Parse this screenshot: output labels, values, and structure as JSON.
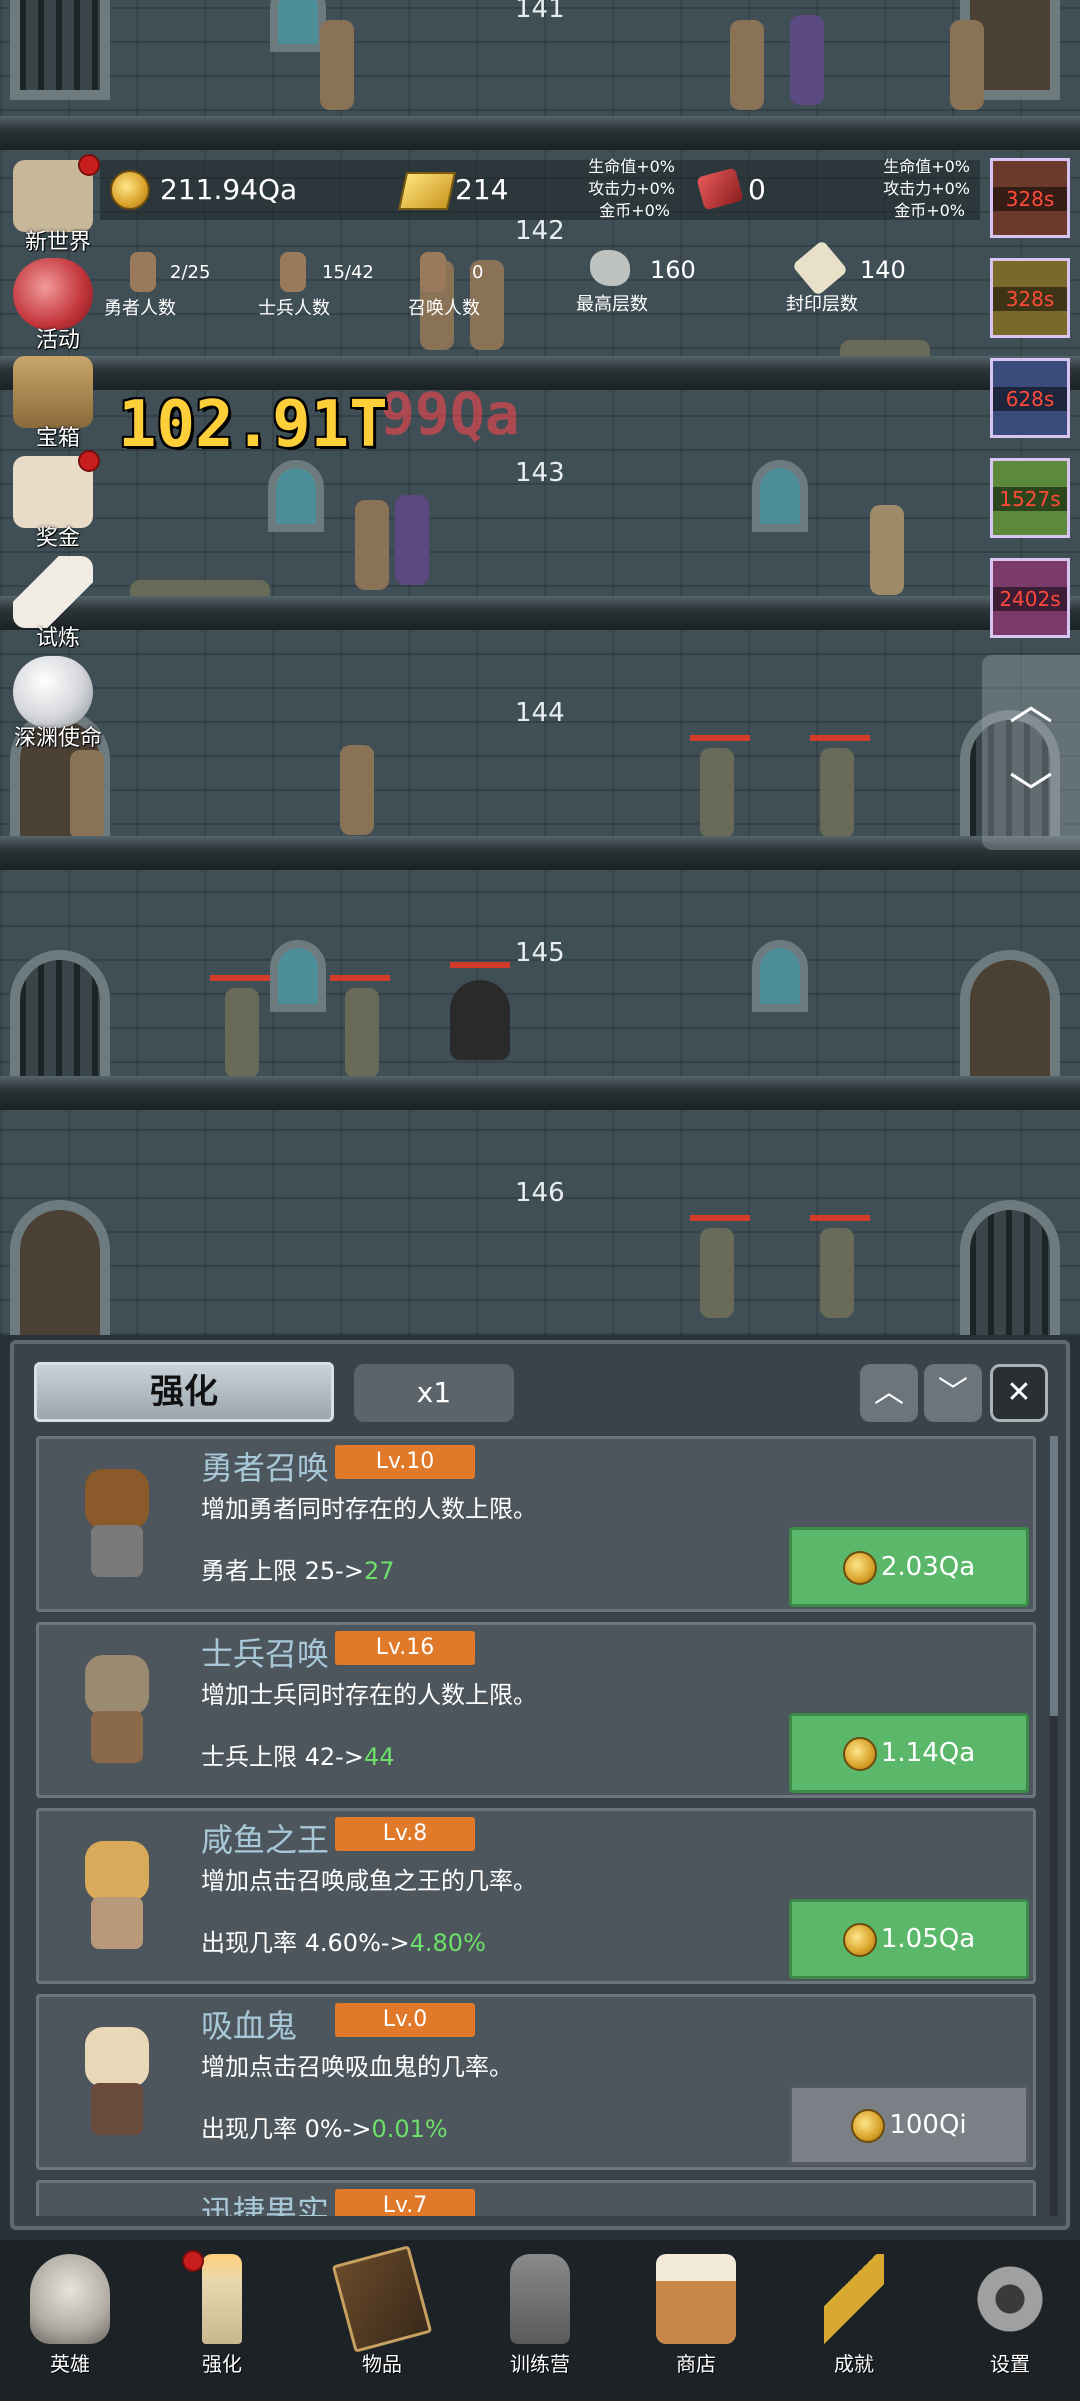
{
  "resources": {
    "gold": "211.94Qa",
    "gold_bars": "214",
    "gems": "0",
    "buff_left": {
      "hp": "生命值+0%",
      "atk": "攻击力+0%",
      "coin": "金币+0%"
    },
    "buff_right": {
      "hp": "生命值+0%",
      "atk": "攻击力+0%",
      "coin": "金币+0%"
    }
  },
  "counts": {
    "heroes": {
      "value": "2/25",
      "label": "勇者人数"
    },
    "soldiers": {
      "value": "15/42",
      "label": "士兵人数"
    },
    "summons": {
      "value": "0",
      "label": "召唤人数"
    },
    "max_floor": {
      "value": "160",
      "label": "最高层数"
    },
    "seal_floor": {
      "value": "140",
      "label": "封印层数"
    }
  },
  "floors": [
    "142",
    "143",
    "144",
    "145",
    "146"
  ],
  "floor_top_partial": "141",
  "damage_text": "102.91T",
  "damage_text_faded": "99Qa",
  "side_menu": [
    {
      "label": "新世界",
      "dot": true
    },
    {
      "label": "活动",
      "dot": false
    },
    {
      "label": "宝箱",
      "dot": false
    },
    {
      "label": "奖金",
      "dot": true
    },
    {
      "label": "试炼",
      "dot": false
    },
    {
      "label": "深渊使命",
      "dot": false
    }
  ],
  "timers": [
    "328s",
    "328s",
    "628s",
    "1527s",
    "2402s"
  ],
  "scroll": {
    "up": "︿",
    "down": "﹀"
  },
  "panel": {
    "tab": "强化",
    "multiplier": "x1",
    "up": "︿",
    "down": "﹀",
    "close": "✕"
  },
  "upgrades": [
    {
      "name": "勇者召唤",
      "level": "Lv.10",
      "desc": "增加勇者同时存在的人数上限。",
      "effect_prefix": "勇者上限 25->",
      "effect_new": "27",
      "cost": "2.03Qa",
      "affordable": true
    },
    {
      "name": "士兵召唤",
      "level": "Lv.16",
      "desc": "增加士兵同时存在的人数上限。",
      "effect_prefix": "士兵上限 42->",
      "effect_new": "44",
      "cost": "1.14Qa",
      "affordable": true
    },
    {
      "name": "咸鱼之王",
      "level": "Lv.8",
      "desc": "增加点击召唤咸鱼之王的几率。",
      "effect_prefix": "出现几率 4.60%->",
      "effect_new": "4.80%",
      "cost": "1.05Qa",
      "affordable": true
    },
    {
      "name": "吸血鬼",
      "level": "Lv.0",
      "desc": "增加点击召唤吸血鬼的几率。",
      "effect_prefix": "出现几率 0%->",
      "effect_new": "0.01%",
      "cost": "100Qi",
      "affordable": false
    },
    {
      "name": "迅捷果实",
      "level": "Lv.7"
    }
  ],
  "nav": [
    {
      "label": "英雄",
      "icon": "skull-icon",
      "dot": false
    },
    {
      "label": "强化",
      "icon": "candle-icon",
      "dot": true
    },
    {
      "label": "物品",
      "icon": "book-icon",
      "dot": false
    },
    {
      "label": "训练营",
      "icon": "lantern-icon",
      "dot": false
    },
    {
      "label": "商店",
      "icon": "beer-mug-icon",
      "dot": false
    },
    {
      "label": "成就",
      "icon": "key-icon",
      "dot": false
    },
    {
      "label": "设置",
      "icon": "gear-icon",
      "dot": false
    }
  ]
}
